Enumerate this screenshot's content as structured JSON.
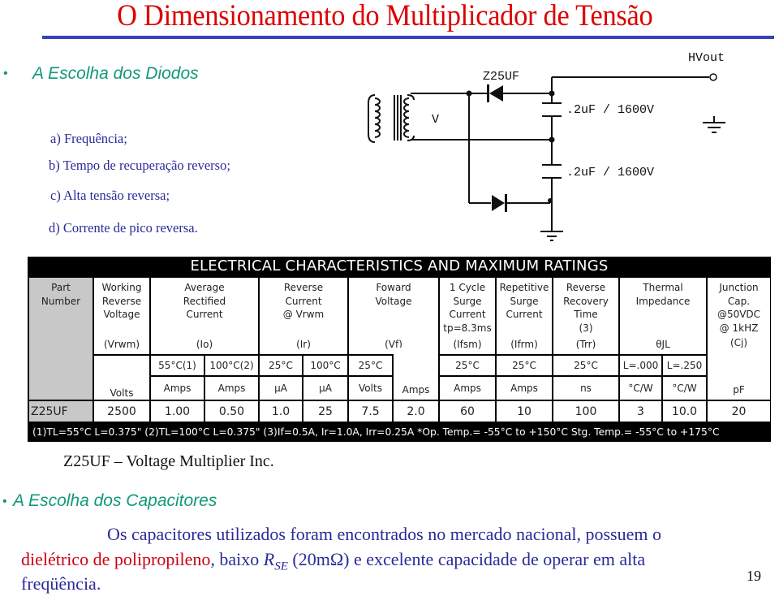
{
  "slide": {
    "title": "O Dimensionamento do Multiplicador de Tensão",
    "page_number": "19"
  },
  "section_diodes": {
    "bullet": "•",
    "heading": "A Escolha dos Diodos",
    "criteria": [
      "a) Frequência;",
      "b) Tempo de recuperação reverso;",
      "c) Alta tensão reversa;",
      "d) Corrente de pico reversa."
    ]
  },
  "schematic": {
    "diode_label": "Z25UF",
    "transformer_label": "V",
    "output_label": "HVout",
    "capacitor_labels": [
      ".2uF / 1600V",
      ".2uF / 1600V"
    ]
  },
  "datasheet": {
    "title": "ELECTRICAL CHARACTERISTICS AND MAXIMUM RATINGS",
    "headers": [
      {
        "lines": [
          "Part",
          "Number"
        ],
        "symbol": ""
      },
      {
        "lines": [
          "Working",
          "Reverse",
          "Voltage"
        ],
        "symbol": "(Vrwm)"
      },
      {
        "lines": [
          "Average",
          "Rectified",
          "Current"
        ],
        "symbol": "(Io)"
      },
      {
        "lines": [
          "Reverse",
          "Current",
          "@ Vrwm"
        ],
        "symbol": "(Ir)"
      },
      {
        "lines": [
          "Foward",
          "Voltage"
        ],
        "symbol": "(Vf)"
      },
      {
        "lines": [
          "1 Cycle",
          "Surge",
          "Current",
          "tp=8.3ms"
        ],
        "symbol": "(Ifsm)"
      },
      {
        "lines": [
          "Repetitive",
          "Surge",
          "Current"
        ],
        "symbol": "(Ifrm)"
      },
      {
        "lines": [
          "Reverse",
          "Recovery",
          "Time",
          "(3)"
        ],
        "symbol": "(Trr)"
      },
      {
        "lines": [
          "Thermal",
          "Impedance"
        ],
        "symbol": "θJL"
      },
      {
        "lines": [
          "Junction",
          "Cap.",
          "@50VDC",
          "@ 1kHZ"
        ],
        "symbol": "(Cj)"
      }
    ],
    "conditions": [
      "",
      "",
      "55°C(1)",
      "100°C(2)",
      "25°C",
      "100°C",
      "25°C",
      "",
      "25°C",
      "25°C",
      "25°C",
      "L=.000",
      "L=.250",
      ""
    ],
    "units": [
      "",
      "Volts",
      "Amps",
      "Amps",
      "µA",
      "µA",
      "Volts",
      "Amps",
      "Amps",
      "Amps",
      "ns",
      "°C/W",
      "°C/W",
      "pF"
    ],
    "rows": [
      [
        "Z25UF",
        "2500",
        "1.00",
        "0.50",
        "1.0",
        "25",
        "7.5",
        "2.0",
        "60",
        "10",
        "100",
        "3",
        "10.0",
        "20"
      ]
    ],
    "footnote": "(1)TL=55°C L=0.375\"  (2)TL=100°C L=0.375\"  (3)If=0.5A, Ir=1.0A, Irr=0.25A   *Op. Temp.= -55°C to +150°C   Stg. Temp.= -55°C to +175°C"
  },
  "caption": "Z25UF – Voltage Multiplier Inc.",
  "section_capacitors": {
    "bullet": "•",
    "heading": "A Escolha dos Capacitores",
    "para_line1": "Os capacitores utilizados foram encontrados no mercado nacional,  possuem o",
    "para_line2_red": "dielétrico de polipropileno",
    "para_line2_a": ", baixo ",
    "para_line2_R": "R",
    "para_line2_sub": "SE",
    "para_line2_b": " (20mΩ) e excelente capacidade de operar em alta",
    "para_line3": "freqüência."
  }
}
